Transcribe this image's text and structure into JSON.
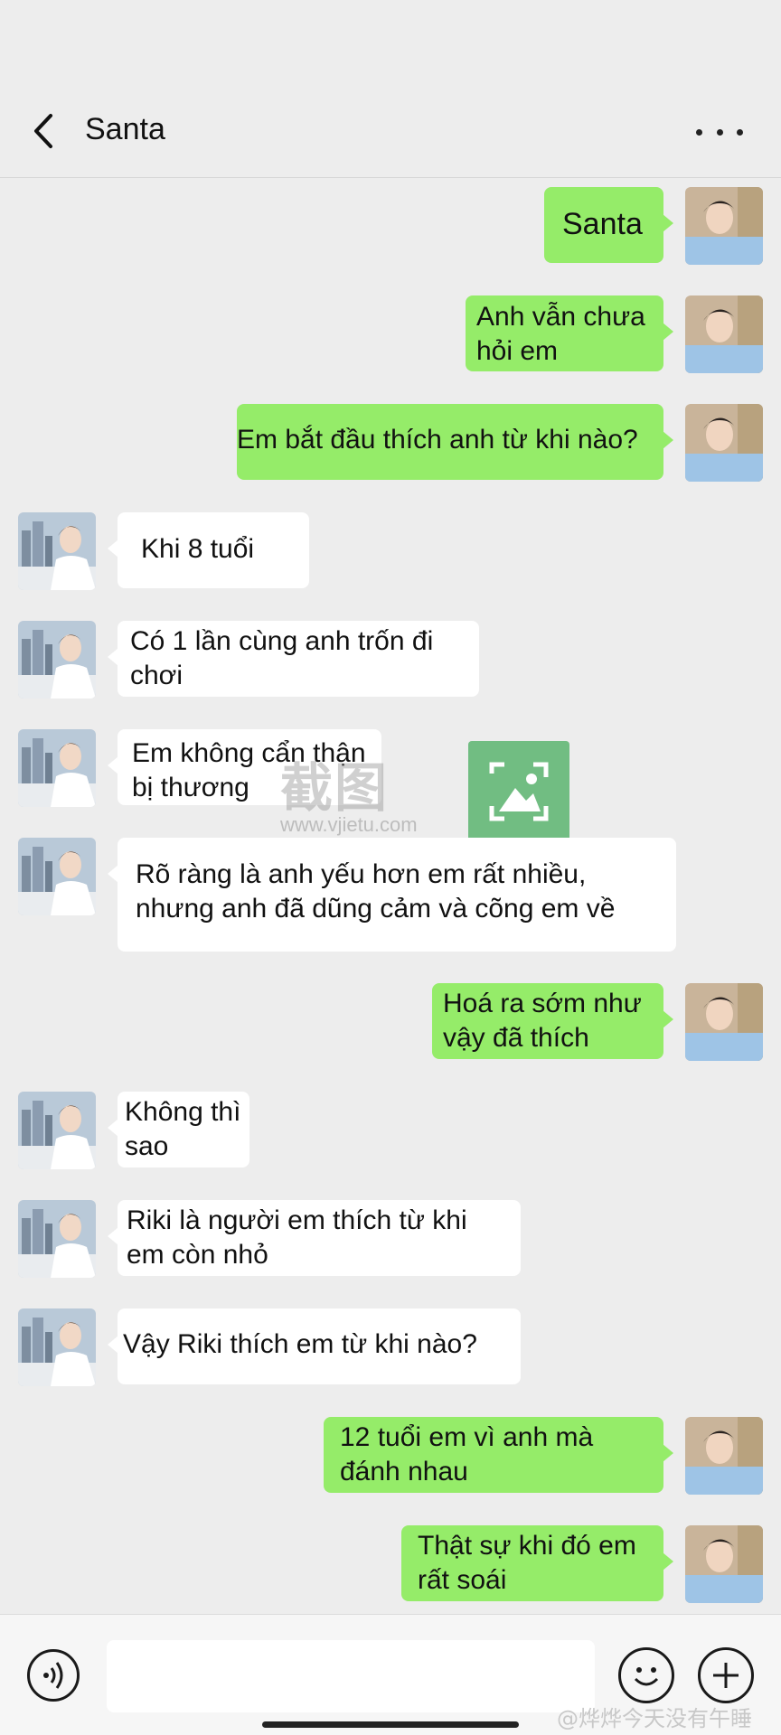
{
  "header": {
    "title": "Santa"
  },
  "messages": [
    {
      "side": "out",
      "text": "Santa"
    },
    {
      "side": "out",
      "text": "Anh vẫn chưa\nhỏi em"
    },
    {
      "side": "out",
      "text": "Em bắt đầu thích anh từ khi nào?"
    },
    {
      "side": "in",
      "text": "Khi 8 tuổi"
    },
    {
      "side": "in",
      "text": "Có 1 lần cùng anh trốn đi\nchơi"
    },
    {
      "side": "in",
      "text": "Em không cẩn thận\nbị thương"
    },
    {
      "side": "in",
      "text": "Rõ ràng là anh yếu hơn em rất nhiều,\nnhưng anh đã dũng cảm và cõng em về"
    },
    {
      "side": "out",
      "text": "Hoá ra sớm như\nvậy đã thích"
    },
    {
      "side": "in",
      "text": "Không thì\nsao"
    },
    {
      "side": "in",
      "text": "Riki là người em thích từ khi\nem còn nhỏ"
    },
    {
      "side": "in",
      "text": "Vậy Riki thích em từ khi nào?"
    },
    {
      "side": "out",
      "text": "12 tuổi em vì anh mà\nđánh nhau"
    },
    {
      "side": "out",
      "text": "Thật sự khi đó em\nrất soái"
    }
  ],
  "watermark": {
    "text": "截图",
    "url": "www.vjietu.com"
  },
  "footer_credit": "@烨烨今天没有午睡",
  "icons": {
    "back": "chevron-left-icon",
    "more": "more-dots-icon",
    "voice": "voice-icon",
    "emoji": "emoji-icon",
    "plus": "plus-icon"
  },
  "colors": {
    "outgoing_bubble": "#95ec69",
    "incoming_bubble": "#ffffff",
    "background": "#ededed"
  }
}
